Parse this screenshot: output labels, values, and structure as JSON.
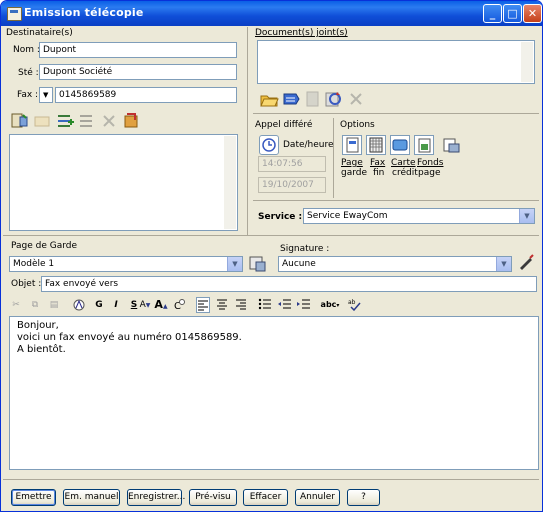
{
  "window": {
    "title": "Emission télécopie",
    "minimize": "_",
    "maximize": "□",
    "close": "✕"
  },
  "recipient": {
    "section_label": "Destinataire(s)",
    "nom_label": "Nom :",
    "nom_value": "Dupont",
    "ste_label": "Sté :",
    "ste_value": "Dupont Société",
    "fax_label": "Fax :",
    "fax_value": "0145869589"
  },
  "documents": {
    "section_label": "Document(s) joint(s)"
  },
  "deferred": {
    "section_label": "Appel différé",
    "date_time_label": "Date/heure",
    "time_value": "14:07:56",
    "date_value": "19/10/2007"
  },
  "options": {
    "section_label": "Options",
    "items": [
      {
        "l1": "Page",
        "l2": "garde"
      },
      {
        "l1": "Fax",
        "l2": "fin"
      },
      {
        "l1": "Carte",
        "l2": "crédit"
      },
      {
        "l1": "Fonds",
        "l2": "page"
      },
      {
        "l1": "",
        "l2": ""
      }
    ]
  },
  "service": {
    "label": "Service :",
    "value": "Service EwayCom"
  },
  "cover": {
    "label": "Page de Garde",
    "value": "Modèle 1"
  },
  "signature": {
    "label": "Signature :",
    "value": "Aucune"
  },
  "subject": {
    "label": "Objet :",
    "value": "Fax envoyé vers"
  },
  "format_toolbar": {
    "bold": "G",
    "italic": "I",
    "underline": "S",
    "abc": "abc"
  },
  "message": {
    "line1": "Bonjour,",
    "line2": "voici un fax envoyé au numéro 0145869589.",
    "line3": "A bientôt."
  },
  "buttons": {
    "emettre": "Emettre",
    "em_manuel": "Em. manuel",
    "enregistrer": "Enregistrer...",
    "previsu": "Pré-visu",
    "effacer": "Effacer",
    "annuler": "Annuler",
    "help": "?"
  }
}
